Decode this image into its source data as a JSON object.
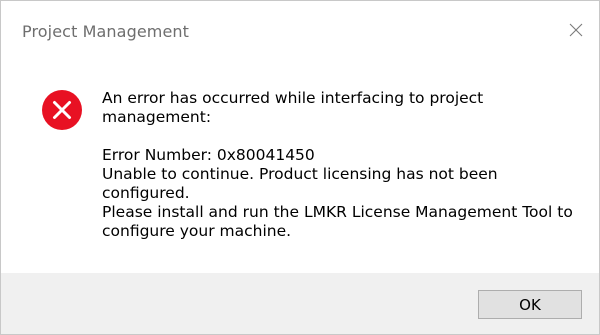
{
  "window": {
    "title": "Project Management",
    "close_icon": "close-icon"
  },
  "body": {
    "icon": "error-icon",
    "icon_color": "#e81123",
    "message_line1": "An error has occurred while interfacing to project",
    "message_line2": "management:",
    "error_number": "Error Number: 0x80041450",
    "detail_line1": "Unable to continue. Product licensing has not been",
    "detail_line2": "configured.",
    "detail_line3": "Please install and run the LMKR License Management Tool to",
    "detail_line4": "configure your machine."
  },
  "footer": {
    "ok_label": "OK"
  }
}
